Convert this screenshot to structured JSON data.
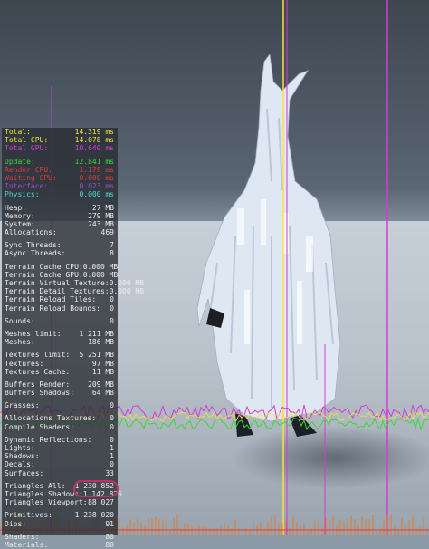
{
  "stats": {
    "timing": [
      {
        "label": "Total:",
        "value": "14.319 ms",
        "color": "#f2e63a"
      },
      {
        "label": "Total CPU:",
        "value": "14.078 ms",
        "color": "#f2e63a"
      },
      {
        "label": "Total GPU:",
        "value": "10.640 ms",
        "color": "#d63ad6"
      }
    ],
    "threads": [
      {
        "label": "Update:",
        "value": "12.841 ms",
        "color": "#38d838"
      },
      {
        "label": "Render CPU:",
        "value": "1.179 ms",
        "color": "#e03a3a"
      },
      {
        "label": "Waiting GPU:",
        "value": "0.000 ms",
        "color": "#e03a3a"
      },
      {
        "label": "Interface:",
        "value": "0.023 ms",
        "color": "#9a4ad8"
      },
      {
        "label": "Physics:",
        "value": "0.000 ms",
        "color": "#4ad8d8"
      }
    ],
    "memory": [
      {
        "label": "Heap:",
        "value": "27 MB"
      },
      {
        "label": "Memory:",
        "value": "279 MB"
      },
      {
        "label": "System:",
        "value": "243 MB"
      },
      {
        "label": "Allocations:",
        "value": "469"
      }
    ],
    "sync": [
      {
        "label": "Sync Threads:",
        "value": "7"
      },
      {
        "label": "Async Threads:",
        "value": "8"
      }
    ],
    "terrain": [
      {
        "label": "Terrain Cache CPU:",
        "value": "0.000 MB"
      },
      {
        "label": "Terrain Cache GPU:",
        "value": "0.000 MB"
      },
      {
        "label": "Terrain Virtual Texture:",
        "value": "0.000 MB"
      },
      {
        "label": "Terrain Detail Textures:",
        "value": "0.000 MB"
      },
      {
        "label": "Terrain Reload Tiles:",
        "value": "0"
      },
      {
        "label": "Terrain Reload Bounds:",
        "value": "0"
      }
    ],
    "sounds": [
      {
        "label": "Sounds:",
        "value": "0"
      }
    ],
    "meshes": [
      {
        "label": "Meshes limit:",
        "value": "1 211 MB"
      },
      {
        "label": "Meshes:",
        "value": "186 MB"
      }
    ],
    "textures": [
      {
        "label": "Textures limit:",
        "value": "5 251 MB"
      },
      {
        "label": "Textures:",
        "value": "97 MB"
      },
      {
        "label": "Textures Cache:",
        "value": "11 MB"
      }
    ],
    "buffers": [
      {
        "label": "Buffers Render:",
        "value": "209 MB"
      },
      {
        "label": "Buffers Shadows:",
        "value": "64 MB"
      }
    ],
    "grasses": [
      {
        "label": "Grasses:",
        "value": "0"
      }
    ],
    "allocations": [
      {
        "label": "Allocations Textures:",
        "value": "0"
      },
      {
        "label": "Compile Shaders:",
        "value": "0"
      }
    ],
    "scene": [
      {
        "label": "Dynamic Reflections:",
        "value": "0"
      },
      {
        "label": "Lights:",
        "value": "1"
      },
      {
        "label": "Shadows:",
        "value": "1"
      },
      {
        "label": "Decals:",
        "value": "0"
      },
      {
        "label": "Surfaces:",
        "value": "33"
      }
    ],
    "triangles": [
      {
        "label": "Triangles All:",
        "value": "1 230 852"
      },
      {
        "label": "Triangles Shadows:",
        "value": "1 142 825"
      },
      {
        "label": "Triangles Viewport:",
        "value": "88 027"
      }
    ],
    "prims": [
      {
        "label": "Primitives:",
        "value": "1 238 020"
      },
      {
        "label": "Dips:",
        "value": "91"
      }
    ],
    "shaders": [
      {
        "label": "Shaders:",
        "value": "80"
      },
      {
        "label": "Materials:",
        "value": "88"
      }
    ]
  },
  "colors": {
    "default_text": "#ececec",
    "highlight": "#c0306a",
    "graph_total": "#f2e63a",
    "graph_gpu": "#d63ad6",
    "graph_update": "#38d838",
    "graph_render": "#e03a3a"
  }
}
